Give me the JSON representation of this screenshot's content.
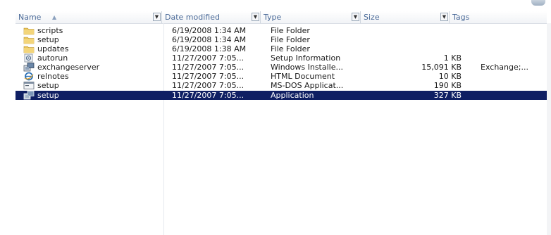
{
  "columns": {
    "name": "Name",
    "date": "Date modified",
    "type": "Type",
    "size": "Size",
    "tags": "Tags"
  },
  "files": [
    {
      "name": "scripts",
      "date": "6/19/2008 1:34 AM",
      "type": "File Folder",
      "size": "",
      "tags": "",
      "icon": "folder-icon"
    },
    {
      "name": "setup",
      "date": "6/19/2008 1:34 AM",
      "type": "File Folder",
      "size": "",
      "tags": "",
      "icon": "folder-icon"
    },
    {
      "name": "updates",
      "date": "6/19/2008 1:38 AM",
      "type": "File Folder",
      "size": "",
      "tags": "",
      "icon": "folder-icon"
    },
    {
      "name": "autorun",
      "date": "11/27/2007 7:05...",
      "type": "Setup Information",
      "size": "1 KB",
      "tags": "",
      "icon": "setup-info-icon"
    },
    {
      "name": "exchangeserver",
      "date": "11/27/2007 7:05...",
      "type": "Windows Installe...",
      "size": "15,091 KB",
      "tags": "Exchange;...",
      "icon": "installer-icon"
    },
    {
      "name": "relnotes",
      "date": "11/27/2007 7:05...",
      "type": "HTML Document",
      "size": "10 KB",
      "tags": "",
      "icon": "html-document-icon"
    },
    {
      "name": "setup",
      "date": "11/27/2007 7:05...",
      "type": "MS-DOS Applicat...",
      "size": "190 KB",
      "tags": "",
      "icon": "msdos-app-icon"
    },
    {
      "name": "setup",
      "date": "11/27/2007 7:05...",
      "type": "Application",
      "size": "327 KB",
      "tags": "",
      "icon": "application-icon",
      "selected": true
    }
  ],
  "colors": {
    "selection": "#0f1f63",
    "header_text": "#4a6a98",
    "folder": "#e8c35a"
  }
}
